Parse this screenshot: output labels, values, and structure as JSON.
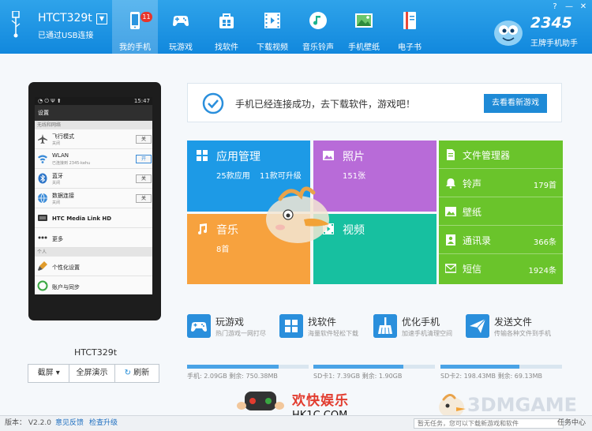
{
  "header": {
    "device_name": "HTCT329t",
    "device_status": "已通过USB连接",
    "dropdown": "▼",
    "nav": [
      {
        "label": "我的手机",
        "icon": "phone-icon",
        "badge": "11",
        "active": true
      },
      {
        "label": "玩游戏",
        "icon": "gamepad-icon"
      },
      {
        "label": "找软件",
        "icon": "bag-icon"
      },
      {
        "label": "下载视频",
        "icon": "film-icon"
      },
      {
        "label": "音乐铃声",
        "icon": "music-icon"
      },
      {
        "label": "手机壁纸",
        "icon": "picture-icon"
      },
      {
        "label": "电子书",
        "icon": "book-icon"
      }
    ],
    "logo_number": "2345",
    "logo_sub": "王牌手机助手",
    "win_buttons": [
      "?",
      "—",
      "✕"
    ]
  },
  "phone": {
    "status_left": "◔ ⏻ Ψ ⬆",
    "status_right": "15:47",
    "title": "设置",
    "section1": "无线和网络",
    "section2": "个人",
    "rows": [
      {
        "title": "飞行模式",
        "sub": "关闭",
        "toggle": "关",
        "on": false
      },
      {
        "title": "WLAN",
        "sub": "已连接到 2345-kehu",
        "toggle": "开",
        "on": true
      },
      {
        "title": "蓝牙",
        "sub": "关闭",
        "toggle": "关",
        "on": false
      },
      {
        "title": "数据连接",
        "sub": "关闭",
        "toggle": "关",
        "on": false
      },
      {
        "title": "HTC Media Link HD",
        "sub": ""
      },
      {
        "title": "更多",
        "sub": ""
      }
    ],
    "rows2": [
      {
        "title": "个性化设置",
        "sub": ""
      },
      {
        "title": "账户与同步",
        "sub": ""
      }
    ],
    "name": "HTCT329t",
    "actions": [
      "截屏 ▾",
      "全屏演示",
      "刷新"
    ]
  },
  "banner": {
    "text": "手机已经连接成功，去下载软件，游戏吧！",
    "button": "去看看新游戏"
  },
  "tiles": {
    "apps": {
      "title": "应用管理",
      "sub1": "25款应用",
      "sub2": "11款可升级"
    },
    "photos": {
      "title": "照片",
      "sub": "151张"
    },
    "music": {
      "title": "音乐",
      "sub": "8首"
    },
    "video": {
      "title": "视频"
    },
    "file_manager": {
      "title": "文件管理器"
    },
    "files": [
      {
        "label": "铃声",
        "value": "179首"
      },
      {
        "label": "壁纸",
        "value": ""
      },
      {
        "label": "通讯录",
        "value": "366条"
      },
      {
        "label": "短信",
        "value": "1924条"
      }
    ]
  },
  "quick_links": [
    {
      "title": "玩游戏",
      "sub": "热门游戏一网打尽",
      "icon": "gamepad-icon"
    },
    {
      "title": "找软件",
      "sub": "海量软件轻松下载",
      "icon": "grid-icon"
    },
    {
      "title": "优化手机",
      "sub": "加速手机清理空间",
      "icon": "broom-icon"
    },
    {
      "title": "发送文件",
      "sub": "传输各种文件到手机",
      "icon": "send-icon"
    }
  ],
  "storage": [
    {
      "label": "手机: 2.09GB  剩余: 750.38MB",
      "fraction": 0.75
    },
    {
      "label": "SD卡1: 7.39GB  剩余: 1.90GB",
      "fraction": 0.74
    },
    {
      "label": "SD卡2: 198.43MB  剩余: 69.13MB",
      "fraction": 0.65
    }
  ],
  "footer": {
    "version": "版本： V2.2.0",
    "feedback": "意见反馈",
    "update": "检查升级",
    "task": "暂无任务，您可以下载新游戏和软件",
    "task_center": "任务中心"
  },
  "watermarks": {
    "site_name": "欢快娱乐",
    "site_url": "HK1C.COM",
    "brand": "3DMGAME"
  },
  "colors": {
    "header": "#1a93e0",
    "tile_apps": "#1d9ae6",
    "tile_photos": "#b86bd8",
    "tile_music": "#f7a23e",
    "tile_video": "#17c0a0",
    "tile_files": "#6ac42b",
    "accent": "#1e8ad6"
  }
}
